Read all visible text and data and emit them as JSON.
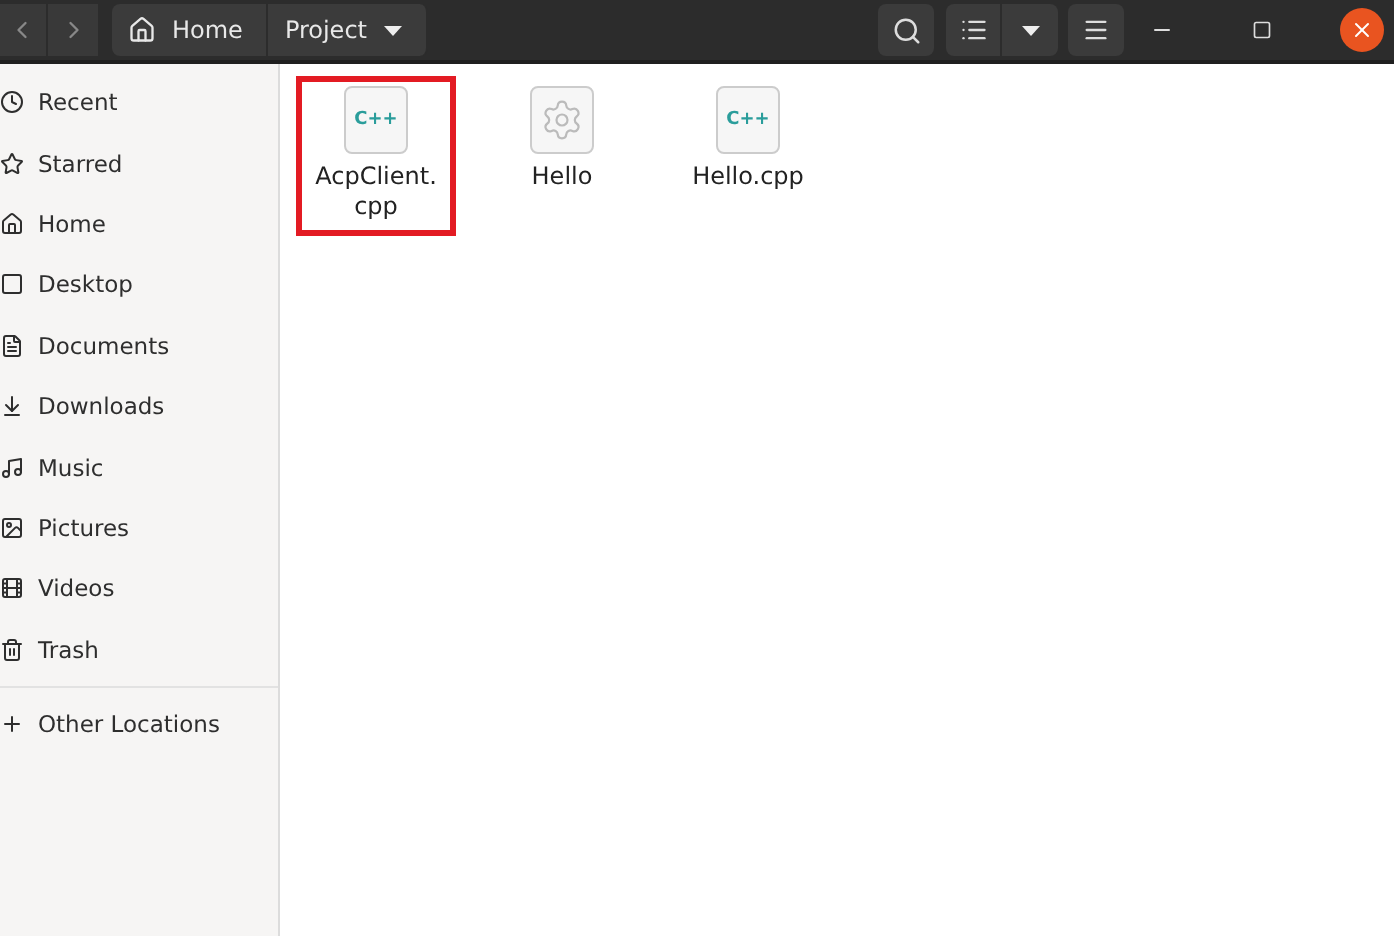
{
  "path": [
    {
      "label": "Home",
      "kind": "home"
    },
    {
      "label": "Project",
      "kind": "folder"
    }
  ],
  "sidebar": {
    "items": [
      {
        "label": "Recent",
        "kind": "recent"
      },
      {
        "label": "Starred",
        "kind": "starred"
      },
      {
        "label": "Home",
        "kind": "home"
      },
      {
        "label": "Desktop",
        "kind": "desktop"
      },
      {
        "label": "Documents",
        "kind": "documents"
      },
      {
        "label": "Downloads",
        "kind": "downloads"
      },
      {
        "label": "Music",
        "kind": "music"
      },
      {
        "label": "Pictures",
        "kind": "pictures"
      },
      {
        "label": "Videos",
        "kind": "videos"
      },
      {
        "label": "Trash",
        "kind": "trash"
      }
    ],
    "other": {
      "label": "Other Locations"
    }
  },
  "files": [
    {
      "name": "AcpClient.\ncpp",
      "kind": "cpp",
      "highlighted": true,
      "badge": "C++"
    },
    {
      "name": "Hello",
      "kind": "executable",
      "highlighted": false
    },
    {
      "name": "Hello.cpp",
      "kind": "cpp",
      "highlighted": false,
      "badge": "C++"
    }
  ]
}
